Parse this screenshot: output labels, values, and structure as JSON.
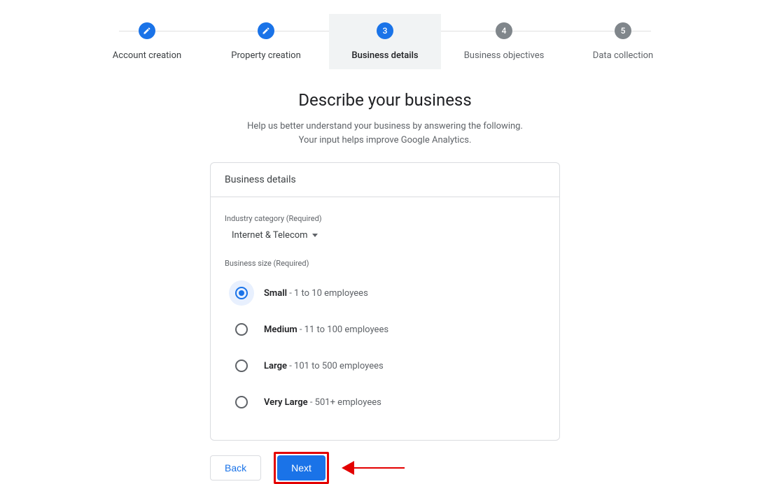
{
  "stepper": {
    "steps": [
      {
        "label": "Account creation",
        "state": "done"
      },
      {
        "label": "Property creation",
        "state": "done"
      },
      {
        "label": "Business details",
        "state": "active",
        "num": "3"
      },
      {
        "label": "Business objectives",
        "state": "pending",
        "num": "4"
      },
      {
        "label": "Data collection",
        "state": "pending",
        "num": "5"
      }
    ]
  },
  "heading": {
    "title": "Describe your business",
    "subtitle_line1": "Help us better understand your business by answering the following.",
    "subtitle_line2": "Your input helps improve Google Analytics."
  },
  "card": {
    "header": "Business details",
    "industry": {
      "label": "Industry category (Required)",
      "value": "Internet & Telecom"
    },
    "size": {
      "label": "Business size (Required)",
      "options": [
        {
          "name": "Small",
          "desc": " - 1 to 10 employees",
          "selected": true
        },
        {
          "name": "Medium",
          "desc": " - 11 to 100 employees",
          "selected": false
        },
        {
          "name": "Large",
          "desc": " - 101 to 500 employees",
          "selected": false
        },
        {
          "name": "Very Large",
          "desc": " - 501+ employees",
          "selected": false
        }
      ]
    }
  },
  "footer": {
    "back": "Back",
    "next": "Next"
  }
}
